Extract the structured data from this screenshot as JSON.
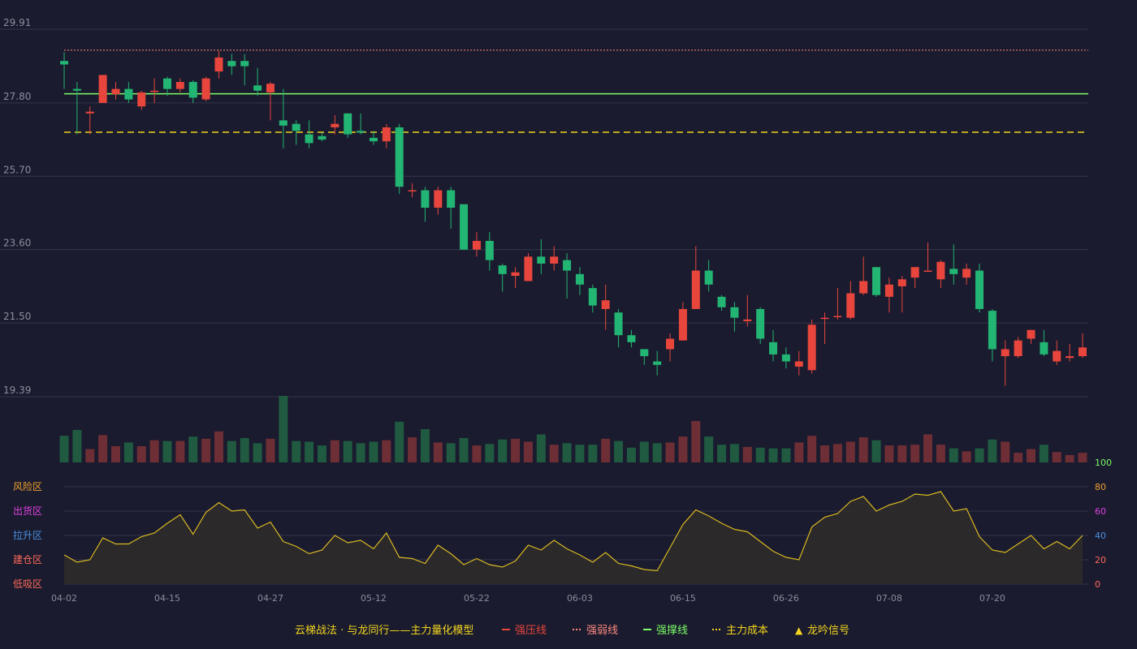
{
  "colors": {
    "background": "#1a1b2e",
    "up": "#e8453c",
    "down": "#22b573",
    "grid": "#34364a",
    "axis_text": "#8b8d9c",
    "pressure_line": "#e8453c",
    "weak_line": "#ff8a80",
    "support_line": "#7cfc66",
    "cost_line": "#f3d51f",
    "osc_line": "#d9b822",
    "osc_fill": "#2e2b2a"
  },
  "chart_data": [
    {
      "type": "candlestick",
      "y_ticks": [
        "29.91",
        "27.80",
        "25.70",
        "23.60",
        "21.50",
        "19.39"
      ],
      "ylim": [
        19.39,
        29.91
      ],
      "x_tick_labels": [
        {
          "index": 0,
          "label": "04-02"
        },
        {
          "index": 8,
          "label": "04-15"
        },
        {
          "index": 16,
          "label": "04-27"
        },
        {
          "index": 24,
          "label": "05-12"
        },
        {
          "index": 32,
          "label": "05-22"
        },
        {
          "index": 40,
          "label": "06-03"
        },
        {
          "index": 48,
          "label": "06-15"
        },
        {
          "index": 56,
          "label": "06-26"
        },
        {
          "index": 64,
          "label": "07-08"
        },
        {
          "index": 72,
          "label": "07-20"
        }
      ],
      "ohlc": [
        [
          29.0,
          28.9,
          28.2,
          29.25
        ],
        [
          28.2,
          28.15,
          26.9,
          28.4
        ],
        [
          27.5,
          27.55,
          26.9,
          27.7
        ],
        [
          27.8,
          28.6,
          27.8,
          28.6
        ],
        [
          28.05,
          28.2,
          27.9,
          28.4
        ],
        [
          28.2,
          27.9,
          27.8,
          28.4
        ],
        [
          27.7,
          28.1,
          27.6,
          28.15
        ],
        [
          28.15,
          28.15,
          27.8,
          28.5
        ],
        [
          28.5,
          28.2,
          28.0,
          28.55
        ],
        [
          28.2,
          28.4,
          28.1,
          28.5
        ],
        [
          28.4,
          27.95,
          27.8,
          28.45
        ],
        [
          27.9,
          28.5,
          27.85,
          28.55
        ],
        [
          28.7,
          29.1,
          28.5,
          29.3
        ],
        [
          29.0,
          28.85,
          28.6,
          29.2
        ],
        [
          29.0,
          28.85,
          28.3,
          29.2
        ],
        [
          28.3,
          28.15,
          28.0,
          28.8
        ],
        [
          28.1,
          28.35,
          27.3,
          28.4
        ],
        [
          27.3,
          27.15,
          26.5,
          28.2
        ],
        [
          27.2,
          27.0,
          26.6,
          27.3
        ],
        [
          26.9,
          26.65,
          26.5,
          27.3
        ],
        [
          26.85,
          26.75,
          26.7,
          26.95
        ],
        [
          27.1,
          27.2,
          26.9,
          27.45
        ],
        [
          27.5,
          26.9,
          26.8,
          27.5
        ],
        [
          27.0,
          26.95,
          26.9,
          27.5
        ],
        [
          26.8,
          26.7,
          26.6,
          27.0
        ],
        [
          26.7,
          27.1,
          26.5,
          27.2
        ],
        [
          27.1,
          25.4,
          25.2,
          27.2
        ],
        [
          25.3,
          25.3,
          25.1,
          25.5
        ],
        [
          25.3,
          24.8,
          24.4,
          25.4
        ],
        [
          24.8,
          25.3,
          24.6,
          25.4
        ],
        [
          25.3,
          24.8,
          24.2,
          25.4
        ],
        [
          24.9,
          23.6,
          23.6,
          24.9
        ],
        [
          23.6,
          23.85,
          23.4,
          24.1
        ],
        [
          23.85,
          23.3,
          23.0,
          24.1
        ],
        [
          23.15,
          22.9,
          22.4,
          23.2
        ],
        [
          22.85,
          22.95,
          22.5,
          23.1
        ],
        [
          22.7,
          23.4,
          22.7,
          23.5
        ],
        [
          23.4,
          23.2,
          22.9,
          23.9
        ],
        [
          23.2,
          23.4,
          23.0,
          23.7
        ],
        [
          23.3,
          23.0,
          22.2,
          23.5
        ],
        [
          22.9,
          22.6,
          22.3,
          23.1
        ],
        [
          22.5,
          22.0,
          21.8,
          22.6
        ],
        [
          21.9,
          22.15,
          21.3,
          22.6
        ],
        [
          21.8,
          21.15,
          20.8,
          21.9
        ],
        [
          21.15,
          20.95,
          20.8,
          21.3
        ],
        [
          20.75,
          20.55,
          20.3,
          20.75
        ],
        [
          20.4,
          20.3,
          20.0,
          20.7
        ],
        [
          20.75,
          21.05,
          20.4,
          21.2
        ],
        [
          21.0,
          21.9,
          21.0,
          22.1
        ],
        [
          21.9,
          23.0,
          21.9,
          23.7
        ],
        [
          23.0,
          22.6,
          22.4,
          23.3
        ],
        [
          22.25,
          21.95,
          21.85,
          22.3
        ],
        [
          21.95,
          21.65,
          21.25,
          22.1
        ],
        [
          21.55,
          21.6,
          21.4,
          22.3
        ],
        [
          21.9,
          21.05,
          20.9,
          21.95
        ],
        [
          20.95,
          20.6,
          20.4,
          21.3
        ],
        [
          20.6,
          20.4,
          20.2,
          20.8
        ],
        [
          20.25,
          20.4,
          20.0,
          20.7
        ],
        [
          20.15,
          21.45,
          20.05,
          21.6
        ],
        [
          21.65,
          21.65,
          20.9,
          21.8
        ],
        [
          21.7,
          21.7,
          21.6,
          22.5
        ],
        [
          21.65,
          22.35,
          21.6,
          22.7
        ],
        [
          22.35,
          22.7,
          22.3,
          23.4
        ],
        [
          23.1,
          22.3,
          22.25,
          23.1
        ],
        [
          22.25,
          22.6,
          21.8,
          22.8
        ],
        [
          22.55,
          22.75,
          21.8,
          22.85
        ],
        [
          22.8,
          23.1,
          22.5,
          23.1
        ],
        [
          23.0,
          23.0,
          23.0,
          23.8
        ],
        [
          22.75,
          23.25,
          22.5,
          23.3
        ],
        [
          23.05,
          22.9,
          22.6,
          23.75
        ],
        [
          22.8,
          23.05,
          22.6,
          23.2
        ],
        [
          23.0,
          21.9,
          21.8,
          23.2
        ],
        [
          21.85,
          20.75,
          20.4,
          21.9
        ],
        [
          20.55,
          20.75,
          19.7,
          21.0
        ],
        [
          20.55,
          21.0,
          20.5,
          21.1
        ],
        [
          21.05,
          21.3,
          20.9,
          21.3
        ],
        [
          20.95,
          20.6,
          20.55,
          21.3
        ],
        [
          20.4,
          20.7,
          20.3,
          21.0
        ],
        [
          20.5,
          20.55,
          20.4,
          20.9
        ],
        [
          20.55,
          20.8,
          20.5,
          21.2
        ]
      ],
      "ref_lines": {
        "pressure": 29.31,
        "support": 28.06,
        "cost": 26.96
      }
    },
    {
      "type": "bar",
      "name": "volume",
      "volume": [
        36,
        44,
        18,
        37,
        22,
        27,
        22,
        30,
        29,
        29,
        35,
        32,
        42,
        29,
        33,
        26,
        32,
        90,
        29,
        28,
        23,
        30,
        29,
        26,
        28,
        30,
        55,
        34,
        45,
        27,
        26,
        33,
        23,
        25,
        31,
        32,
        28,
        38,
        24,
        26,
        24,
        24,
        32,
        29,
        20,
        28,
        26,
        27,
        35,
        56,
        35,
        24,
        25,
        21,
        20,
        19,
        19,
        27,
        36,
        23,
        25,
        28,
        34,
        30,
        23,
        23,
        24,
        38,
        24,
        19,
        15,
        19,
        31,
        28,
        13,
        18,
        24,
        14,
        10,
        13
      ]
    },
    {
      "type": "area",
      "name": "oscillator",
      "ylim": [
        0,
        100
      ],
      "right_ticks": [
        "100",
        "80",
        "60",
        "40",
        "20",
        "0"
      ],
      "zones": [
        {
          "label": "风险区",
          "value": 80
        },
        {
          "label": "出货区",
          "value": 60
        },
        {
          "label": "拉升区",
          "value": 40
        },
        {
          "label": "建仓区",
          "value": 20
        },
        {
          "label": "低吸区",
          "value": 0
        }
      ],
      "values": [
        24,
        18,
        20,
        38,
        33,
        33,
        39,
        42,
        50,
        57,
        41,
        59,
        67,
        60,
        61,
        46,
        51,
        35,
        31,
        25,
        28,
        40,
        34,
        36,
        29,
        42,
        22,
        21,
        17,
        32,
        25,
        16,
        21,
        16,
        14,
        19,
        32,
        28,
        36,
        29,
        24,
        18,
        26,
        17,
        15,
        12,
        11,
        30,
        49,
        61,
        56,
        50,
        45,
        43,
        35,
        27,
        22,
        20,
        47,
        55,
        58,
        68,
        72,
        60,
        65,
        68,
        74,
        73,
        76,
        60,
        62,
        39,
        28,
        26,
        33,
        40,
        29,
        35,
        29,
        40
      ]
    }
  ],
  "legend": {
    "title": "云梯战法 · 与龙同行——主力量化模型",
    "items": [
      {
        "symbol": "—",
        "label": "强压线",
        "color": "#e8453c"
      },
      {
        "symbol": "----",
        "label": "强弱线",
        "color": "#ff8a80"
      },
      {
        "symbol": "—",
        "label": "强撑线",
        "color": "#7cfc66"
      },
      {
        "symbol": "----",
        "label": "主力成本",
        "color": "#f3d51f"
      },
      {
        "symbol": "▲",
        "label": "龙吟信号",
        "color": "#f3d51f"
      }
    ]
  }
}
